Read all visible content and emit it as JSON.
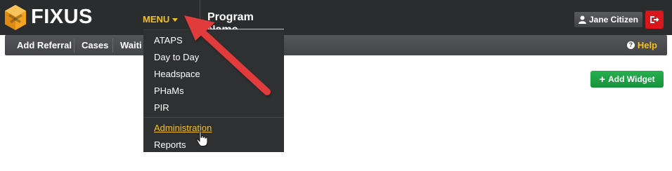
{
  "brand": {
    "name": "FIXUS",
    "icon": "fixus-cube-logo-icon"
  },
  "header": {
    "menu_label": "MENU",
    "program_name": "Program Name",
    "user_name": "Jane Citizen",
    "user_icon": "user-icon",
    "logout_icon": "logout-icon"
  },
  "subnav": {
    "items": [
      "Add Referral",
      "Cases",
      "Waiti"
    ],
    "help_label": "Help",
    "help_icon": "question-circle-icon"
  },
  "menu": {
    "programs": [
      "ATAPS",
      "Day to Day",
      "Headspace",
      "PHaMs",
      "PIR"
    ],
    "admin_items": [
      "Administration",
      "Reports"
    ]
  },
  "actions": {
    "add_widget_label": "Add Widget",
    "add_widget_icon": "plus-icon"
  },
  "annotation": {
    "arrow_color": "#e23a3a",
    "cursor_icon": "hand-pointer-icon"
  },
  "colors": {
    "accent": "#f2c023",
    "topbar": "#2b2c2e",
    "subnav": "#4a4b4e",
    "logout": "#d8161b",
    "add_widget": "#1ea146"
  }
}
